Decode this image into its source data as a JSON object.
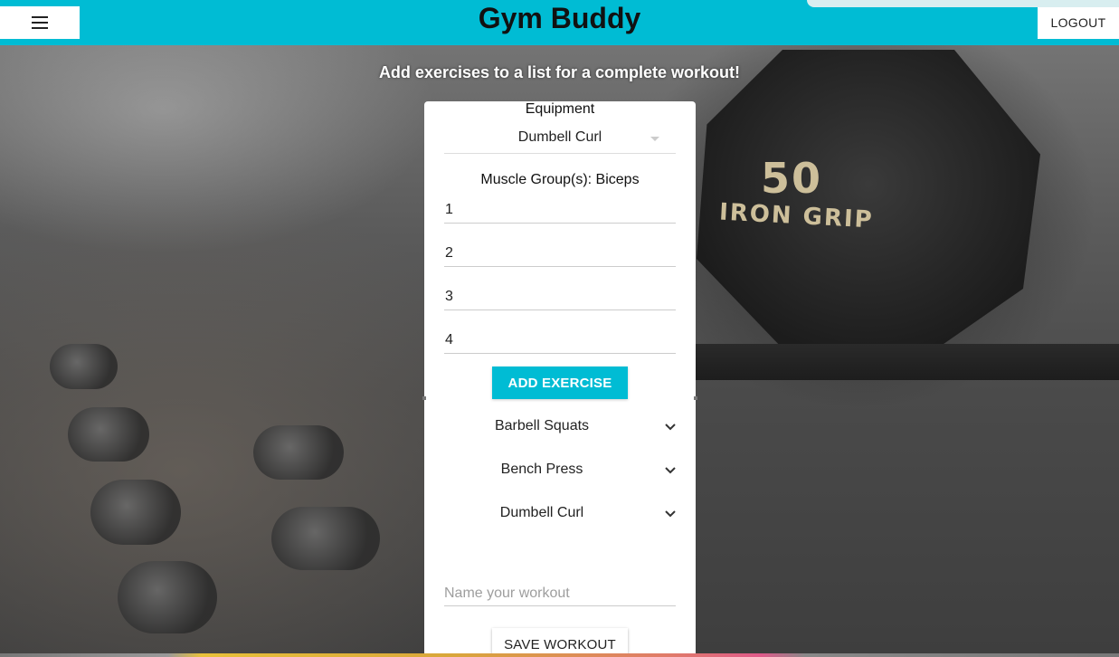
{
  "app": {
    "title": "Gym Buddy",
    "logout_label": "LOGOUT",
    "menu_icon": "hamburger-menu-icon",
    "accent_color": "#00bcd4"
  },
  "tagline": "Add exercises to a list for a complete workout!",
  "form": {
    "equipment_label": "Equipment",
    "equipment_selected": "Dumbell Curl",
    "muscle_group_text": "Muscle Group(s): Biceps",
    "inputs": [
      "1",
      "2",
      "3",
      "4"
    ],
    "add_button_label": "ADD EXERCISE"
  },
  "exercises": [
    {
      "name": "Barbell Squats",
      "icon": "chevron-down-icon"
    },
    {
      "name": "Bench Press",
      "icon": "chevron-down-icon"
    },
    {
      "name": "Dumbell Curl",
      "icon": "chevron-down-icon"
    }
  ],
  "workout": {
    "name_placeholder": "Name your workout",
    "name_value": "",
    "save_button_label": "SAVE WORKOUT"
  },
  "background": {
    "plate_number": "50",
    "plate_brand": "IRON GRIP"
  }
}
